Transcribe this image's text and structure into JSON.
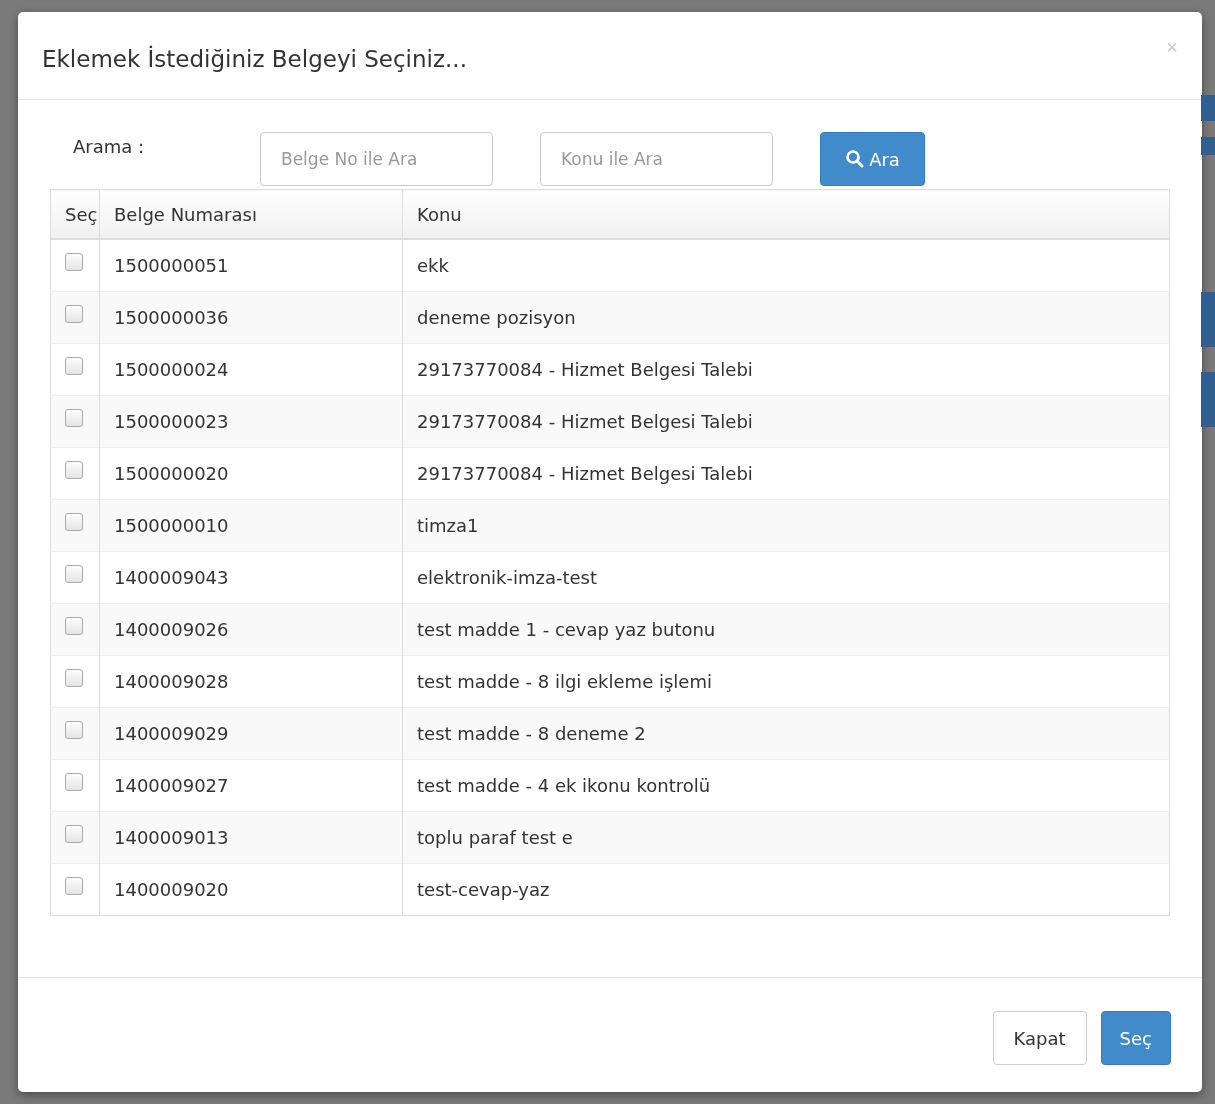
{
  "dialog": {
    "title": "Eklemek İstediğiniz Belgeyi Seçiniz...",
    "close": "×"
  },
  "search": {
    "label": "Arama :",
    "fields": [
      {
        "placeholder": "Belge No ile Ara"
      },
      {
        "placeholder": "Konu ile Ara"
      }
    ],
    "button": "Ara"
  },
  "table": {
    "columns": [
      "Seç",
      "Belge Numarası",
      "Konu"
    ],
    "rows": [
      {
        "checked": false,
        "number": "1500000051",
        "subject": "ekk"
      },
      {
        "checked": false,
        "number": "1500000036",
        "subject": "deneme pozisyon"
      },
      {
        "checked": false,
        "number": "1500000024",
        "subject": "29173770084 - Hizmet Belgesi Talebi"
      },
      {
        "checked": false,
        "number": "1500000023",
        "subject": "29173770084 - Hizmet Belgesi Talebi"
      },
      {
        "checked": false,
        "number": "1500000020",
        "subject": "29173770084 - Hizmet Belgesi Talebi"
      },
      {
        "checked": false,
        "number": "1500000010",
        "subject": "timza1"
      },
      {
        "checked": false,
        "number": "1400009043",
        "subject": "elektronik-imza-test"
      },
      {
        "checked": false,
        "number": "1400009026",
        "subject": "test madde 1 - cevap yaz butonu"
      },
      {
        "checked": false,
        "number": "1400009028",
        "subject": "test madde - 8 ilgi ekleme işlemi"
      },
      {
        "checked": false,
        "number": "1400009029",
        "subject": "test madde - 8 deneme 2"
      },
      {
        "checked": false,
        "number": "1400009027",
        "subject": "test madde - 4 ek ikonu kontrolü"
      },
      {
        "checked": false,
        "number": "1400009013",
        "subject": "toplu paraf test e"
      },
      {
        "checked": false,
        "number": "1400009020",
        "subject": "test-cevap-yaz"
      }
    ]
  },
  "footer": {
    "buttons": [
      {
        "kind": "default",
        "label": "Kapat"
      },
      {
        "kind": "primary",
        "label": "Seç"
      }
    ]
  }
}
